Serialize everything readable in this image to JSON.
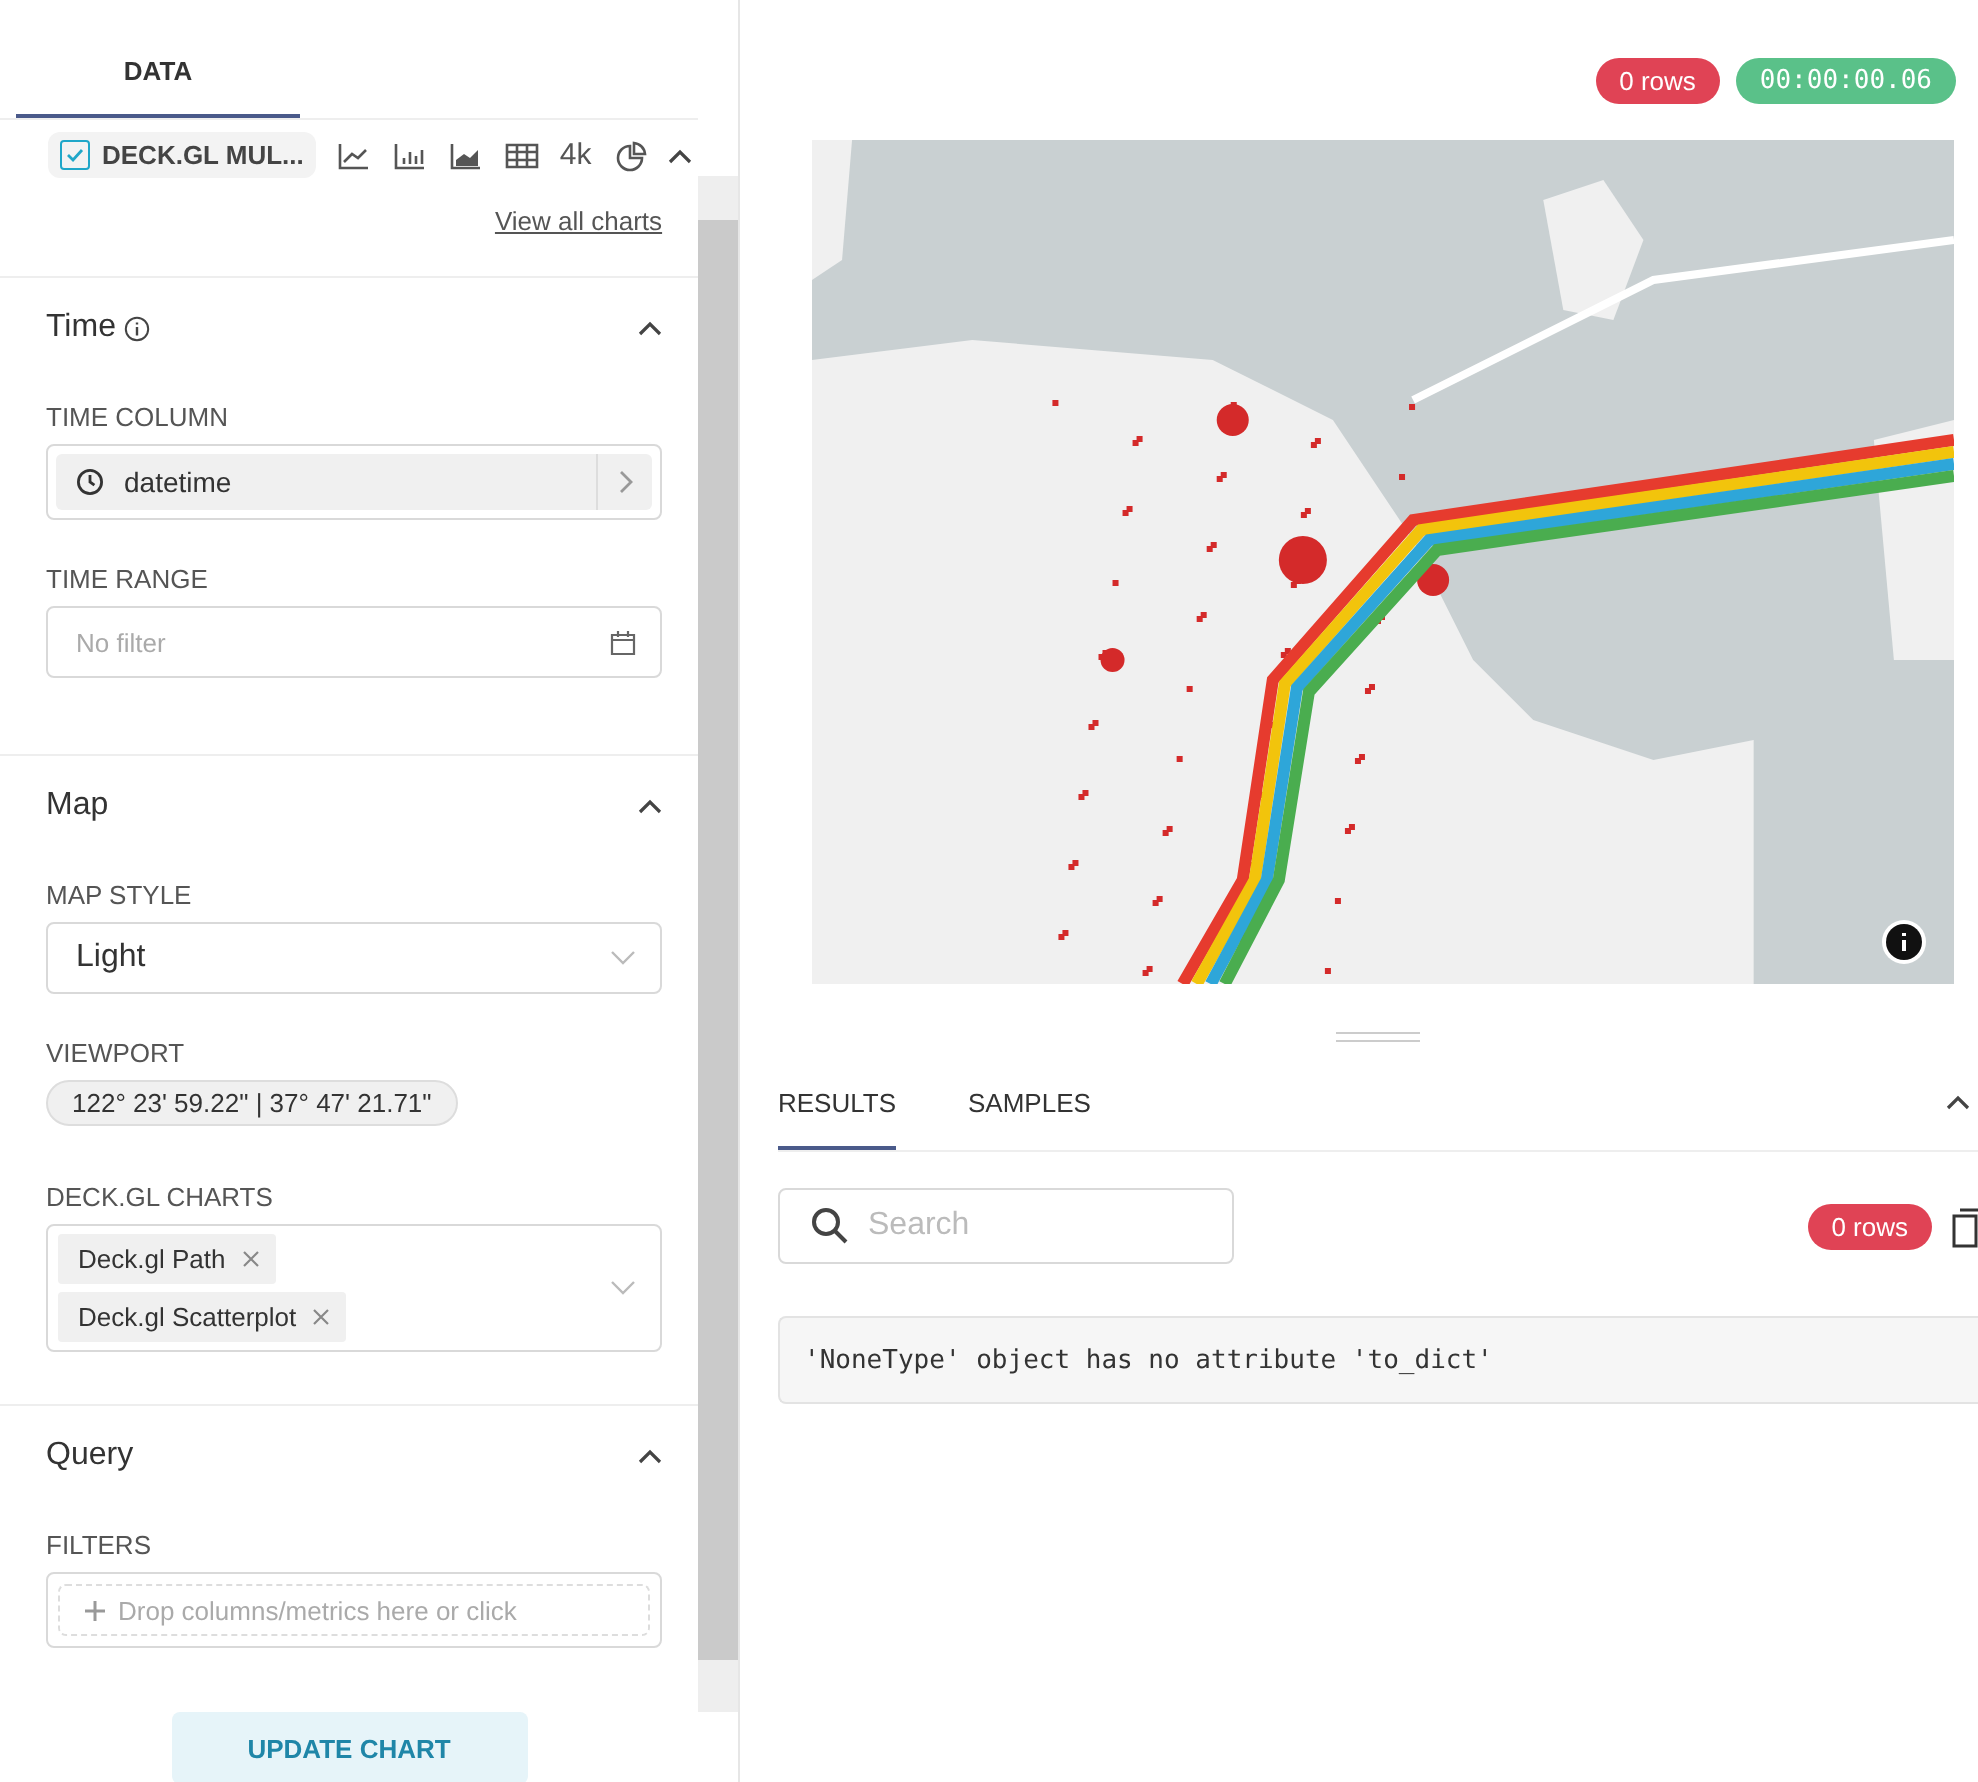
{
  "left_tabs": [
    {
      "label": "DATA",
      "selected": true
    }
  ],
  "chart_type": {
    "label": "DECK.GL MUL...",
    "checked": true
  },
  "quick_viz": [
    {
      "kind": "line"
    },
    {
      "kind": "bar"
    },
    {
      "kind": "area"
    },
    {
      "kind": "table"
    },
    {
      "kind": "text",
      "label": "4k"
    },
    {
      "kind": "pie"
    }
  ],
  "view_all_link": "View all charts",
  "sections": [
    {
      "title": "Time",
      "info": true,
      "expanded": true,
      "controls": [
        {
          "kind": "column",
          "label": "TIME COLUMN",
          "value": "datetime"
        },
        {
          "kind": "date",
          "label": "TIME RANGE",
          "placeholder": "No filter"
        }
      ]
    },
    {
      "title": "Map",
      "info": false,
      "expanded": true,
      "controls": [
        {
          "kind": "select",
          "label": "MAP STYLE",
          "value": "Light"
        },
        {
          "kind": "pill",
          "label": "VIEWPORT",
          "value": "122° 23' 59.22\" | 37° 47' 21.71\""
        },
        {
          "kind": "multi",
          "label": "DECK.GL CHARTS",
          "tags": [
            "Deck.gl Path",
            "Deck.gl Scatterplot"
          ]
        }
      ]
    },
    {
      "title": "Query",
      "info": false,
      "expanded": true,
      "controls": [
        {
          "kind": "drop",
          "label": "FILTERS",
          "placeholder": "Drop columns/metrics here or click"
        }
      ]
    }
  ],
  "update_button": "UPDATE CHART",
  "header_badges": [
    {
      "text": "0 rows",
      "color": "#e04355"
    },
    {
      "text": "00:00:00.06",
      "color": "#5ac189"
    }
  ],
  "results_tabs": [
    {
      "label": "RESULTS",
      "selected": true
    },
    {
      "label": "SAMPLES",
      "selected": false
    }
  ],
  "search": {
    "placeholder": "Search"
  },
  "results_badge": {
    "text": "0 rows",
    "color": "#e04355"
  },
  "error_message": "'NoneType' object has no attribute 'to_dict'"
}
